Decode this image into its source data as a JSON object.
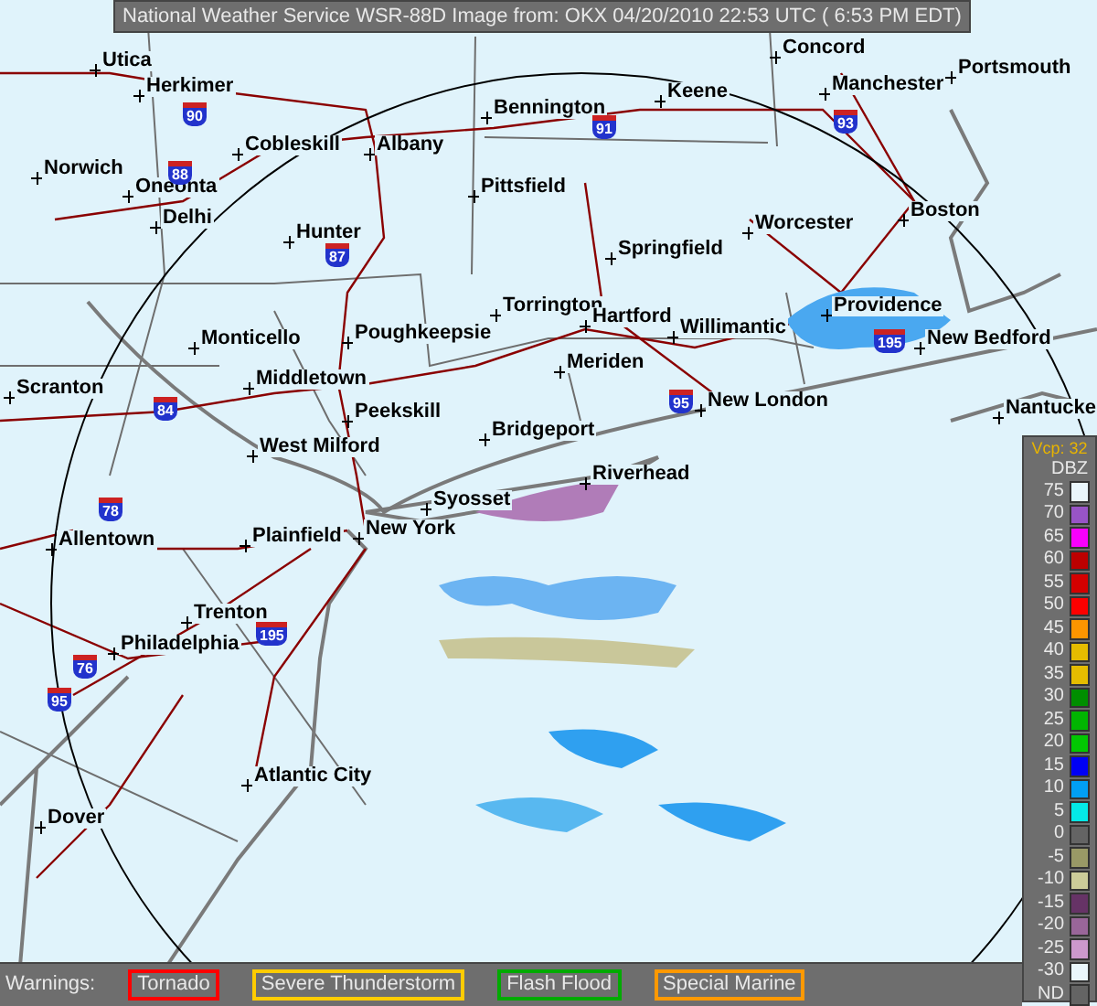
{
  "title": "National Weather Service WSR-88D Image from: OKX 04/20/2010 22:53 UTC ( 6:53 PM EDT)",
  "map": {
    "cities": [
      {
        "name": "Concord"
      },
      {
        "name": "Utica"
      },
      {
        "name": "Herkimer"
      },
      {
        "name": "Portsmouth"
      },
      {
        "name": "Manchester"
      },
      {
        "name": "Keene"
      },
      {
        "name": "Bennington"
      },
      {
        "name": "Cobleskill"
      },
      {
        "name": "Albany"
      },
      {
        "name": "Norwich"
      },
      {
        "name": "Oneonta"
      },
      {
        "name": "Delhi"
      },
      {
        "name": "Pittsfield"
      },
      {
        "name": "Boston"
      },
      {
        "name": "Worcester"
      },
      {
        "name": "Hunter"
      },
      {
        "name": "Springfield"
      },
      {
        "name": "Torrington"
      },
      {
        "name": "Hartford"
      },
      {
        "name": "Providence"
      },
      {
        "name": "Willimantic"
      },
      {
        "name": "Monticello"
      },
      {
        "name": "Poughkeepsie"
      },
      {
        "name": "New Bedford"
      },
      {
        "name": "Meriden"
      },
      {
        "name": "Scranton"
      },
      {
        "name": "Middletown"
      },
      {
        "name": "New London"
      },
      {
        "name": "Peekskill"
      },
      {
        "name": "Nantucke"
      },
      {
        "name": "Bridgeport"
      },
      {
        "name": "West Milford"
      },
      {
        "name": "Riverhead"
      },
      {
        "name": "Syosset"
      },
      {
        "name": "Allentown"
      },
      {
        "name": "Plainfield"
      },
      {
        "name": "New York"
      },
      {
        "name": "Trenton"
      },
      {
        "name": "Philadelphia"
      },
      {
        "name": "Atlantic City"
      },
      {
        "name": "Dover"
      }
    ],
    "highways": [
      {
        "number": "90"
      },
      {
        "number": "88"
      },
      {
        "number": "91"
      },
      {
        "number": "93"
      },
      {
        "number": "87"
      },
      {
        "number": "195"
      },
      {
        "number": "84"
      },
      {
        "number": "95"
      },
      {
        "number": "78"
      },
      {
        "number": "195"
      },
      {
        "number": "76"
      },
      {
        "number": "95"
      }
    ]
  },
  "legend": {
    "vcp": "Vcp: 32",
    "unit": "DBZ",
    "levels": [
      {
        "label": "75",
        "color": "#eaf6fb"
      },
      {
        "label": "70",
        "color": "#9854c6"
      },
      {
        "label": "65",
        "color": "#f800fd"
      },
      {
        "label": "60",
        "color": "#bc0000"
      },
      {
        "label": "55",
        "color": "#d40000"
      },
      {
        "label": "50",
        "color": "#fd0000"
      },
      {
        "label": "45",
        "color": "#fd9500"
      },
      {
        "label": "40",
        "color": "#e5bc00"
      },
      {
        "label": "35",
        "color": "#e5bc00"
      },
      {
        "label": "30",
        "color": "#008e00"
      },
      {
        "label": "25",
        "color": "#01b501"
      },
      {
        "label": "20",
        "color": "#02c802"
      },
      {
        "label": "15",
        "color": "#0000f6"
      },
      {
        "label": "10",
        "color": "#019ff4"
      },
      {
        "label": "5",
        "color": "#04e9e7"
      },
      {
        "label": "0",
        "color": "#646464"
      },
      {
        "label": "-5",
        "color": "#999966"
      },
      {
        "label": "-10",
        "color": "#cccc99"
      },
      {
        "label": "-15",
        "color": "#663366"
      },
      {
        "label": "-20",
        "color": "#996699"
      },
      {
        "label": "-25",
        "color": "#cc99cc"
      },
      {
        "label": "-30",
        "color": "#eaf6fb"
      },
      {
        "label": "ND",
        "color": "#646464"
      }
    ]
  },
  "warnings": {
    "label": "Warnings:",
    "items": [
      {
        "name": "Tornado",
        "color": "#ff0000"
      },
      {
        "name": "Severe Thunderstorm",
        "color": "#ffcc00"
      },
      {
        "name": "Flash Flood",
        "color": "#00aa00"
      },
      {
        "name": "Special Marine",
        "color": "#ff9900"
      }
    ]
  }
}
